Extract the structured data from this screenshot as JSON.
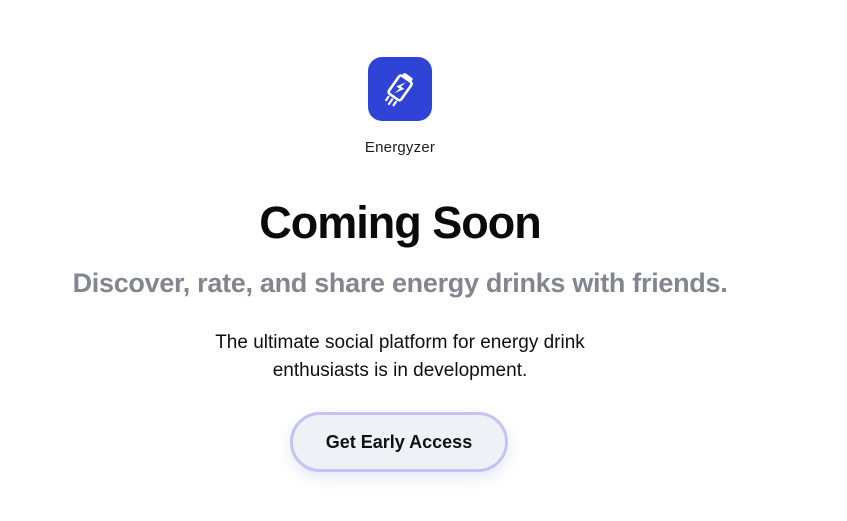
{
  "brand": {
    "app_name": "Energyzer",
    "icon": "energy-can-rocket-icon",
    "icon_bg_color": "#2f43d6"
  },
  "hero": {
    "headline": "Coming Soon",
    "subheadline": "Discover, rate, and share energy drinks with friends.",
    "description": "The ultimate social platform for energy drink enthusiasts is in development."
  },
  "cta": {
    "label": "Get Early Access"
  },
  "colors": {
    "subheadline": "#82868f",
    "button_border": "#c3c4f0",
    "button_bg": "#f0f1f6"
  }
}
